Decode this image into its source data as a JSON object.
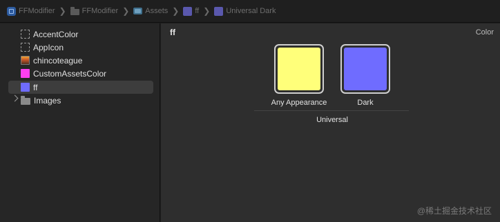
{
  "pathbar": {
    "crumbs": [
      "FFModifier",
      "FFModifier",
      "Assets",
      "ff",
      "Universal Dark"
    ],
    "crumb_icons": [
      "xcode-project-icon",
      "folder-icon",
      "asset-catalog-icon",
      "color-set-icon",
      "color-set-icon"
    ]
  },
  "sidebar": {
    "items": [
      {
        "label": "AccentColor",
        "icon": "empty-color-set-icon"
      },
      {
        "label": "AppIcon",
        "icon": "empty-appicon-icon"
      },
      {
        "label": "chincoteague",
        "icon": "image-set-icon"
      },
      {
        "label": "CustomAssetsColor",
        "icon": "color-swatch-icon",
        "color": "#ff3ff0"
      },
      {
        "label": "ff",
        "icon": "color-swatch-icon",
        "color": "#6f6cff",
        "selected": true
      },
      {
        "label": "Images",
        "icon": "folder-icon",
        "disclosure": "collapsed"
      }
    ]
  },
  "main": {
    "title": "ff",
    "kind": "Color",
    "wells": [
      {
        "label": "Any Appearance",
        "color": "#ffff7a"
      },
      {
        "label": "Dark",
        "color": "#6f6cff"
      }
    ],
    "group_label": "Universal"
  },
  "watermark": "@稀土掘金技术社区"
}
